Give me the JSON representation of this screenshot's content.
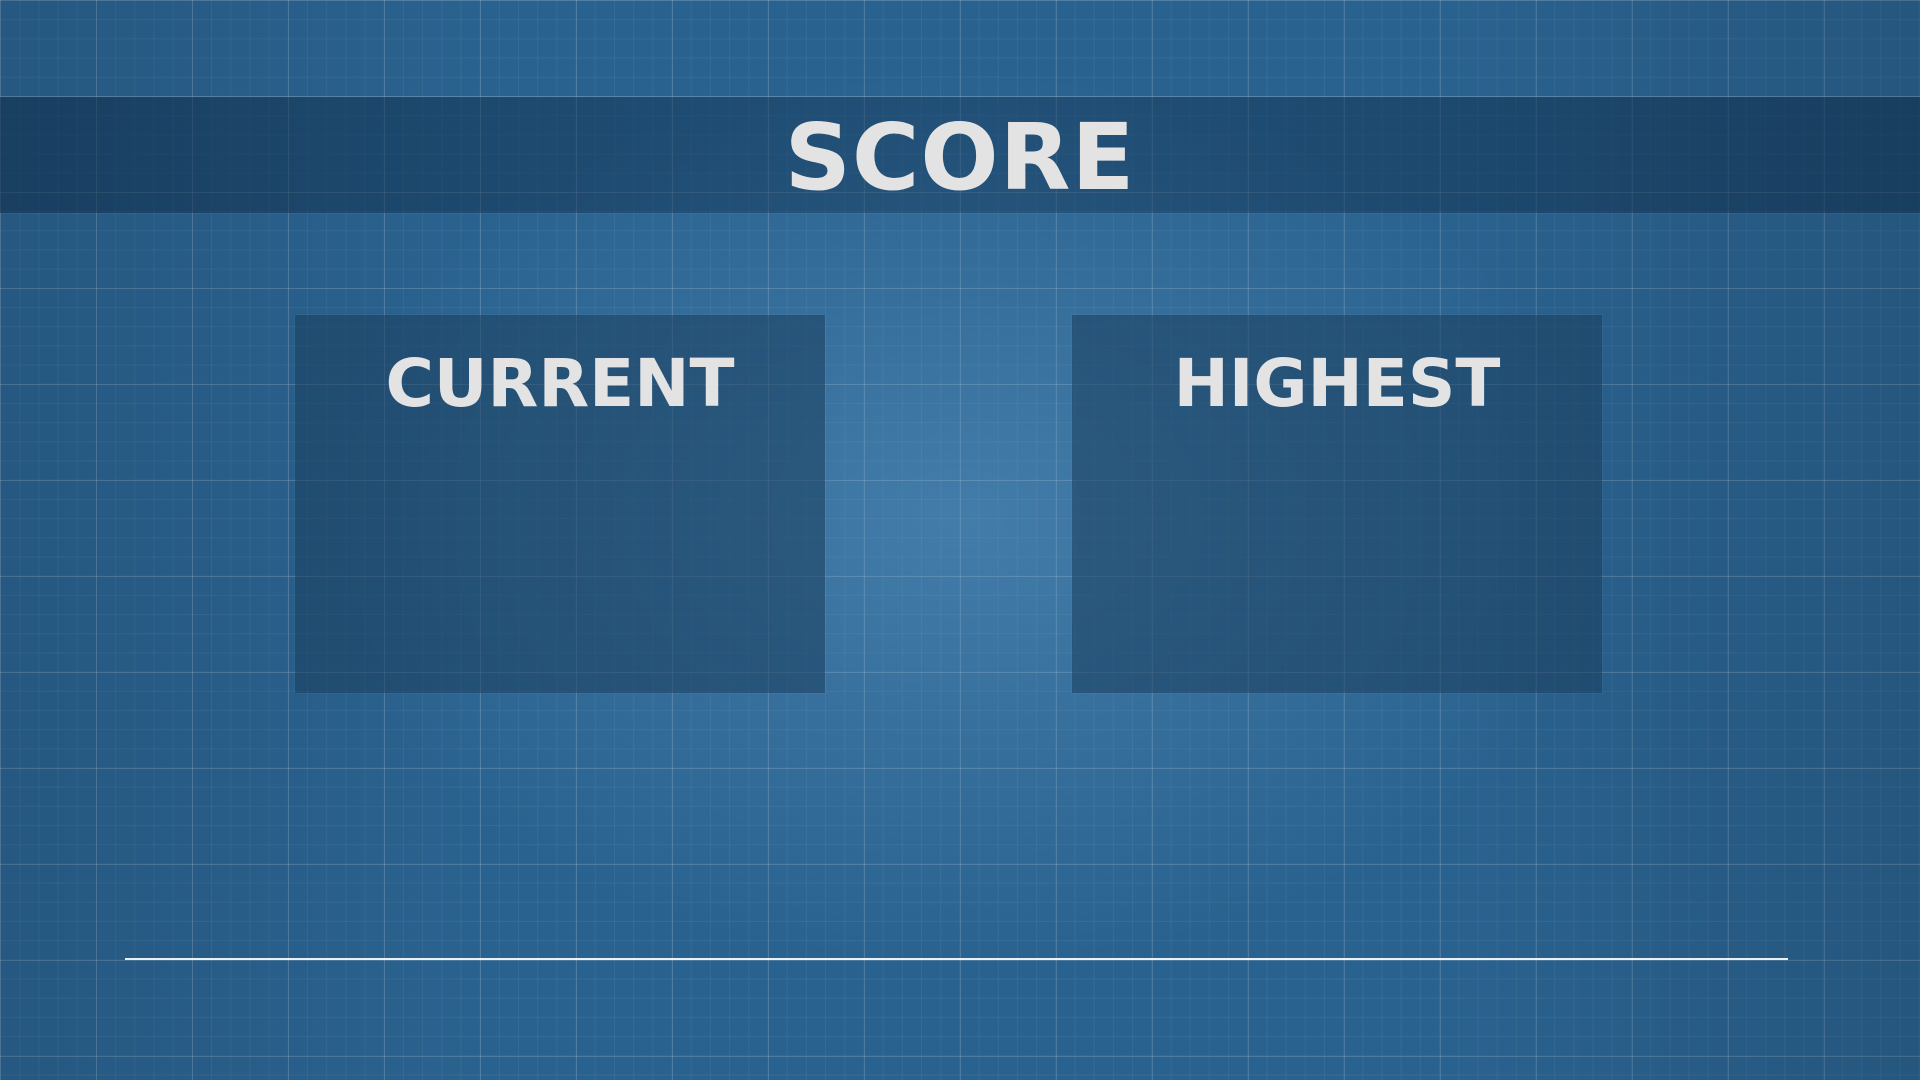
{
  "header": {
    "title": "SCORE"
  },
  "panels": {
    "current": {
      "label": "CURRENT",
      "value": ""
    },
    "highest": {
      "label": "HIGHEST",
      "value": ""
    }
  },
  "colors": {
    "background": "#2a628f",
    "text": "#e3e3e3",
    "panel": "#1c3e5c",
    "divider": "#ffffff"
  }
}
